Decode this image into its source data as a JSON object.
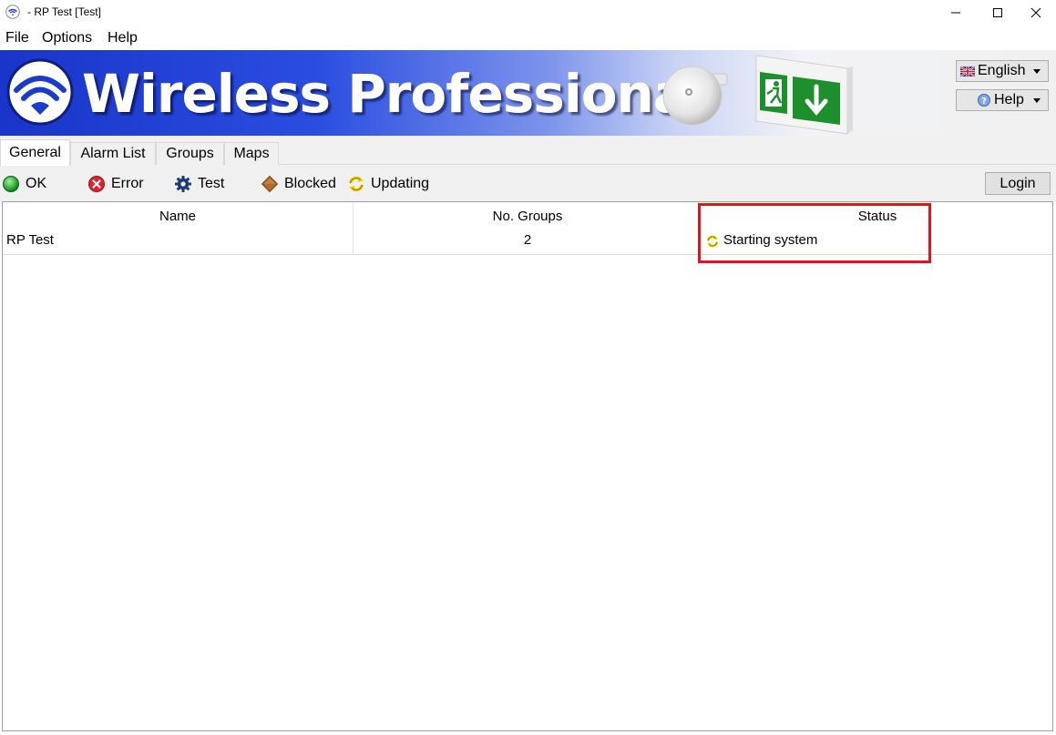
{
  "window": {
    "title": "- RP Test [Test]"
  },
  "menu": {
    "items": [
      "File",
      "Options",
      "Help"
    ]
  },
  "banner": {
    "title": "Wireless Professional",
    "language_label": "English",
    "help_label": "Help"
  },
  "tabs": [
    {
      "label": "General",
      "active": true
    },
    {
      "label": "Alarm List",
      "active": false
    },
    {
      "label": "Groups",
      "active": false
    },
    {
      "label": "Maps",
      "active": false
    }
  ],
  "legend": {
    "ok": "OK",
    "error": "Error",
    "test": "Test",
    "blocked": "Blocked",
    "updating": "Updating"
  },
  "login_label": "Login",
  "table": {
    "columns": [
      "Name",
      "No. Groups",
      "Status"
    ],
    "rows": [
      {
        "name": "RP Test",
        "groups": "2",
        "status": "Starting system"
      }
    ]
  },
  "colors": {
    "banner_blue": "#1a35c9",
    "highlight_red": "#e3141e",
    "ok_green": "#1fa82b",
    "error_red": "#d9262e",
    "updating_yellow": "#f2d500"
  }
}
